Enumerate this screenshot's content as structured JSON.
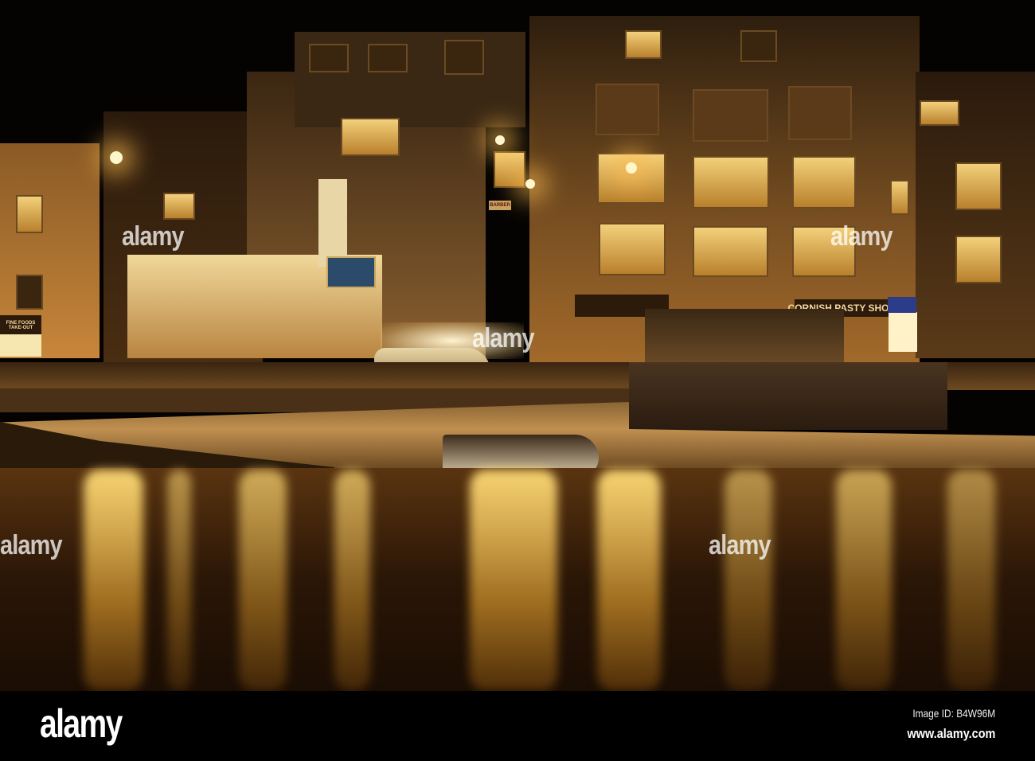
{
  "photo": {
    "signs": {
      "pasty_shop": "CORNISH PASTY SHOP",
      "fine_foods": "FINE FOODS TAKE-OUT",
      "barber": "BARBER"
    },
    "watermark": "alamy"
  },
  "footer": {
    "logo": "alamy",
    "image_id": "Image ID: B4W96M",
    "url": "www.alamy.com"
  },
  "colors": {
    "light": "#f7c15a",
    "water": "#3a1f08",
    "sky": "#050302"
  }
}
